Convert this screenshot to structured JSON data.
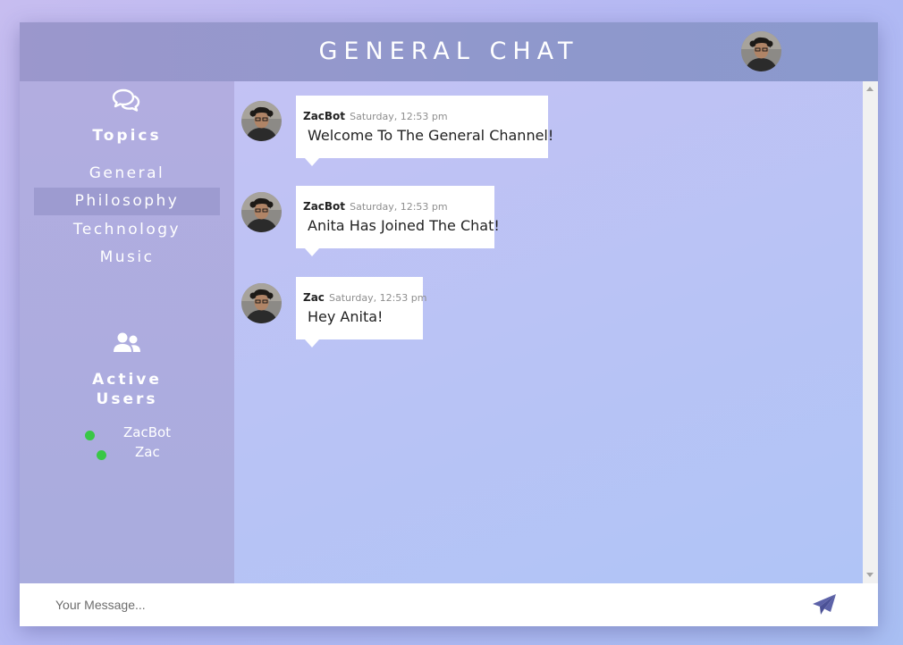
{
  "header": {
    "title": "GENERAL CHAT",
    "avatar_icon": "user-avatar"
  },
  "sidebar": {
    "topics_icon": "chat-bubbles-icon",
    "topics_title": "Topics",
    "topics": [
      {
        "label": "General",
        "active": false
      },
      {
        "label": "Philosophy",
        "active": true
      },
      {
        "label": "Technology",
        "active": false
      },
      {
        "label": "Music",
        "active": false
      }
    ],
    "users_icon": "users-icon",
    "active_users_title_line1": "Active",
    "active_users_title_line2": "Users",
    "users": [
      {
        "name": "ZacBot",
        "status_color": "#39c746"
      },
      {
        "name": "Zac",
        "status_color": "#39c746"
      }
    ]
  },
  "messages": [
    {
      "author": "ZacBot",
      "time": "Saturday, 12:53 pm",
      "text": "Welcome To The General Channel!"
    },
    {
      "author": "ZacBot",
      "time": "Saturday, 12:53 pm",
      "text": "Anita Has Joined The Chat!"
    },
    {
      "author": "Zac",
      "time": "Saturday, 12:53 pm",
      "text": "Hey Anita!"
    }
  ],
  "composer": {
    "placeholder": "Your Message...",
    "send_icon": "paper-plane-icon"
  },
  "colors": {
    "online": "#39c746",
    "send_icon": "#5c62a8",
    "active_topic_bg": "#9d9bd0"
  }
}
